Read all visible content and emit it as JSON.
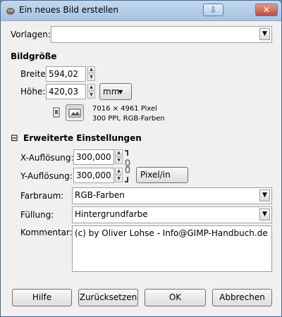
{
  "window": {
    "title": "Ein neues Bild erstellen"
  },
  "template": {
    "label": "Vorlagen:",
    "value": ""
  },
  "image_size": {
    "heading": "Bildgröße",
    "width_label": "Breite:",
    "width_value": "594,02",
    "height_label": "Höhe:",
    "height_value": "420,03",
    "unit": "mm",
    "info_pixels": "7016 × 4961 Pixel",
    "info_ppi": "300 PPI, RGB-Farben"
  },
  "advanced": {
    "expander": "⊟",
    "heading": "Erweiterte Einstellungen",
    "x_res_label": "X-Auflösung:",
    "x_res_value": "300,000",
    "y_res_label": "Y-Auflösung:",
    "y_res_value": "300,000",
    "res_unit": "Pixel/in",
    "colorspace_label": "Farbraum:",
    "colorspace_value": "RGB-Farben",
    "fill_label": "Füllung:",
    "fill_value": "Hintergrundfarbe",
    "comment_label": "Kommentar:",
    "comment_value": "(c) by Oliver Lohse - Info@GIMP-Handbuch.de"
  },
  "buttons": {
    "help": "Hilfe",
    "reset": "Zurücksetzen",
    "ok": "OK",
    "cancel": "Abbrechen"
  },
  "icons": {
    "app": "gimp-icon",
    "minimize": "minimize-icon",
    "close": "close-icon",
    "portrait": "portrait-orientation-icon",
    "landscape": "landscape-orientation-icon",
    "chain": "chain-link-icon",
    "dropdown": "chevron-down-icon"
  },
  "colors": {
    "titlebar": "#a7c3e2",
    "close_button": "#c24a35",
    "dialog_bg": "#f0f0f0"
  }
}
